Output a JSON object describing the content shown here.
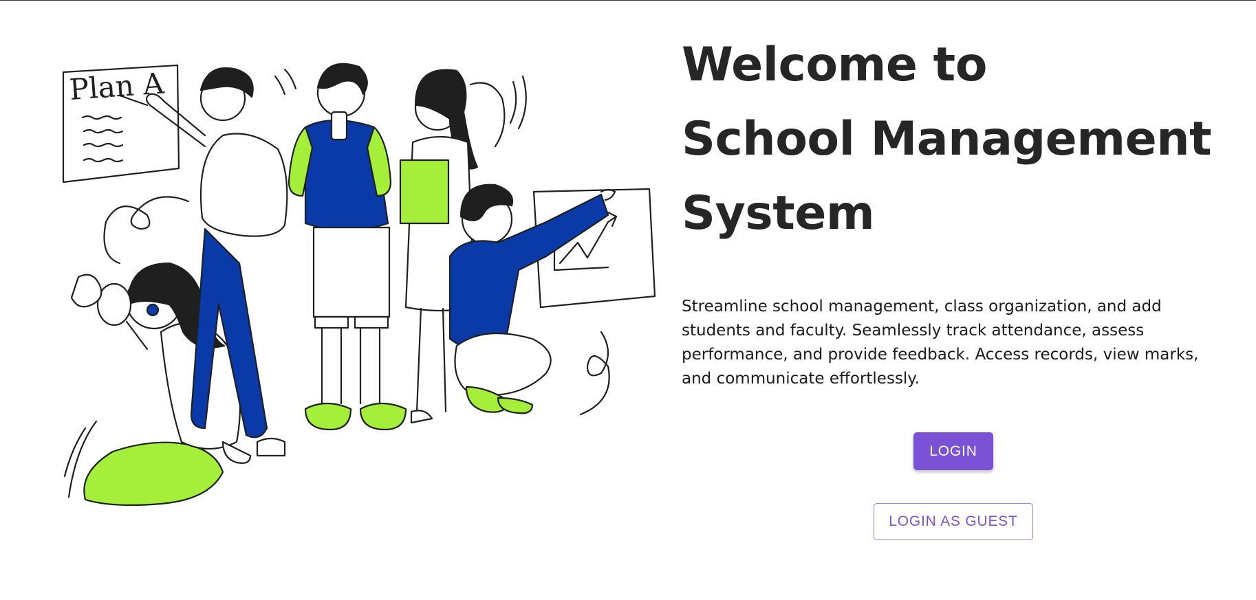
{
  "hero": {
    "title_line1": "Welcome to",
    "title_line2": "School Management",
    "title_line3": "System",
    "description": "Streamline school management, class organization, and add students and faculty. Seamlessly track attendance, assess performance, and provide feedback. Access records, view marks, and communicate effortlessly."
  },
  "illustration": {
    "whiteboard_text": "Plan A"
  },
  "actions": {
    "login_label": "LOGIN",
    "guest_label": "LOGIN AS GUEST"
  },
  "colors": {
    "accent": "#7b52d6",
    "illustration_blue": "#0a3aa8",
    "illustration_green": "#a3ef3a",
    "ink": "#1f1f1f"
  }
}
